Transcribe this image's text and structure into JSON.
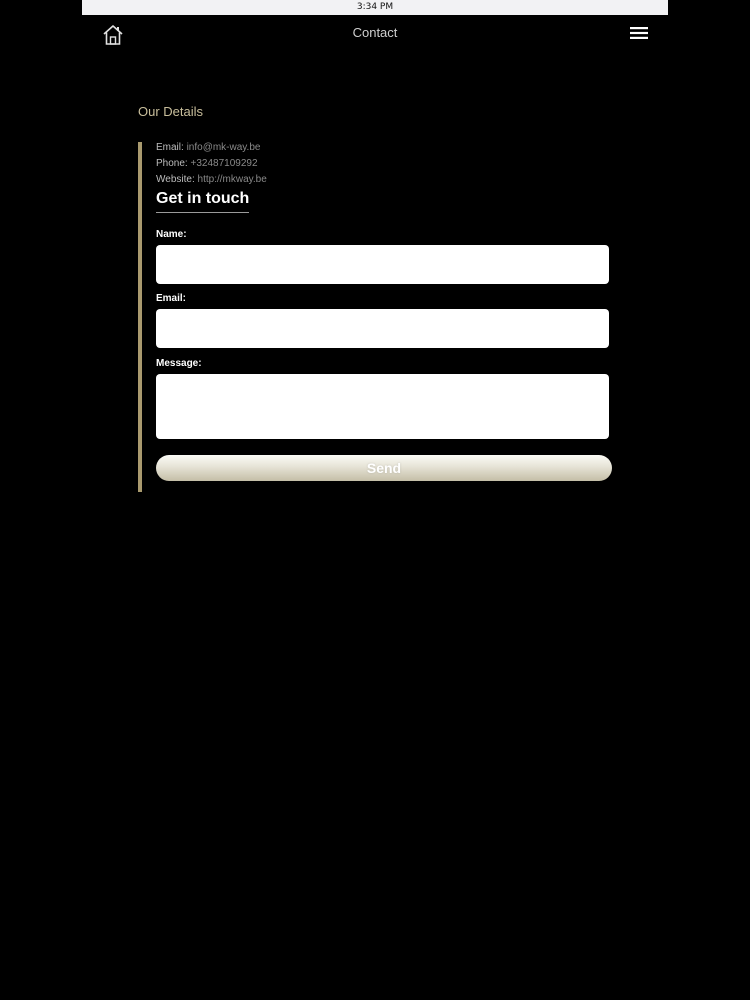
{
  "status_bar": {
    "time": "3:34 PM"
  },
  "navbar": {
    "title": "Contact",
    "home_icon": "home-icon",
    "menu_icon": "hamburger-menu-icon"
  },
  "details": {
    "heading": "Our Details",
    "email_label": "Email:",
    "email_value": "info@mk-way.be",
    "phone_label": "Phone:",
    "phone_value": "+32487109292",
    "website_label": "Website:",
    "website_value": "http://mkway.be"
  },
  "form": {
    "heading": "Get in touch",
    "name_label": "Name:",
    "name_value": "",
    "email_label": "Email:",
    "email_value": "",
    "message_label": "Message:",
    "message_value": "",
    "send_label": "Send"
  },
  "colors": {
    "background": "#000000",
    "accent": "#a99a6e",
    "heading_gold": "#c9bf9c"
  }
}
